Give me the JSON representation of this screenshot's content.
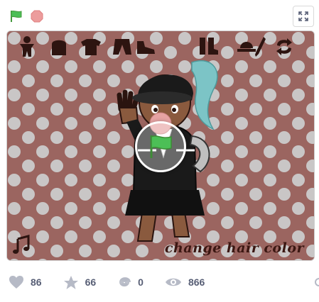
{
  "controls": {
    "green_flag_icon": "green-flag",
    "stop_icon": "stop-sign",
    "fullscreen_icon": "fullscreen"
  },
  "stage": {
    "label": "change hair color",
    "toolbar_icons": [
      "body-icon",
      "hair-icon",
      "shirt-icon",
      "pants-icon",
      "shoes-icon",
      "boots-icon",
      "hat-icon",
      "accessory-icon",
      "swap-icon"
    ],
    "colors": {
      "background": "#9b6560",
      "dots": "#c9c6c6",
      "icons": "#2d1410"
    }
  },
  "stats": {
    "loves": "86",
    "favorites": "66",
    "remixes": "0",
    "views": "866"
  }
}
